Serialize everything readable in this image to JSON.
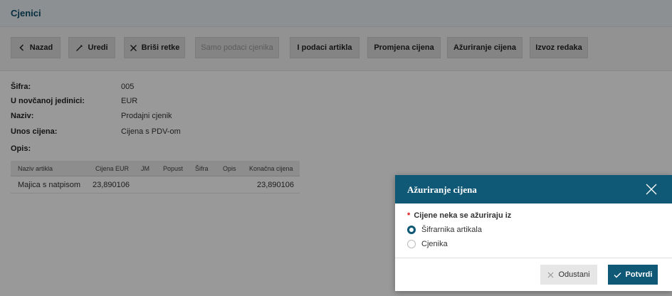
{
  "page": {
    "title": "Cjenici"
  },
  "toolbar": {
    "back": "Nazad",
    "edit": "Uredi",
    "delete_rows": "Briši retke",
    "only_pricelist": "Samo podaci cjenika",
    "item_data": "I podaci artikla",
    "price_change": "Promjena cijena",
    "price_update": "Ažuriranje cijena",
    "export_rows": "Izvoz redaka"
  },
  "details": {
    "sifra_label": "Šifra:",
    "sifra_value": "005",
    "currency_label": "U novčanoj jedinici:",
    "currency_value": "EUR",
    "name_label": "Naziv:",
    "name_value": "Prodajni cjenik",
    "price_entry_label": "Unos cijena:",
    "price_entry_value": "Cijena s PDV-om",
    "desc_label": "Opis:"
  },
  "table": {
    "headers": {
      "item": "Naziv artikla",
      "price": "Cijena EUR",
      "unit": "JM",
      "discount": "Popust",
      "code": "Šifra",
      "desc": "Opis",
      "final": "Konačna cijena"
    },
    "rows": [
      {
        "item": "Majica s natpisom",
        "price": "23,890106",
        "final": "23,890106"
      }
    ]
  },
  "modal": {
    "title": "Ažuriranje cijena",
    "required_mark": "*",
    "field_label": "Cijene neka se ažuriraju iz",
    "options": [
      {
        "label": "Šifrarnika artikala",
        "selected": true
      },
      {
        "label": "Cjenika",
        "selected": false
      }
    ],
    "cancel": "Odustani",
    "confirm": "Potvrdi"
  },
  "colors": {
    "primary": "#0f5876",
    "title": "#0d4e6a"
  }
}
